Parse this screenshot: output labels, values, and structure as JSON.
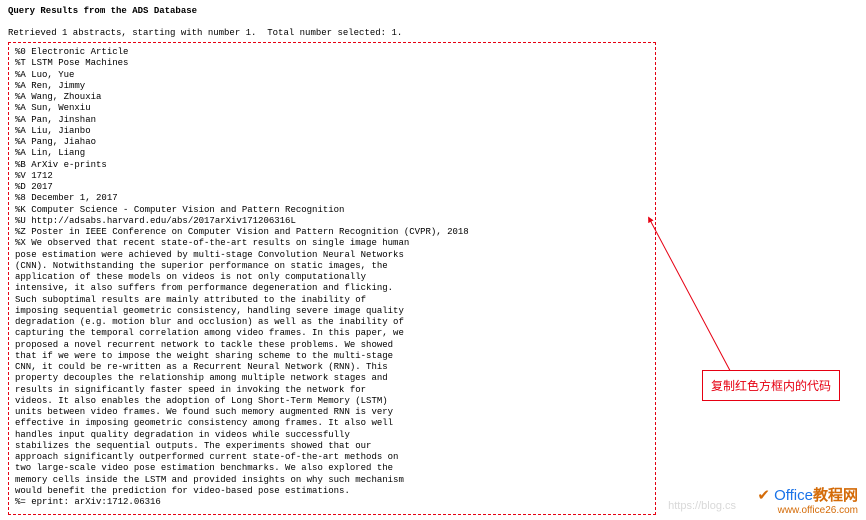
{
  "header": {
    "title": "Query Results from the ADS Database",
    "retrieved": "Retrieved 1 abstracts, starting with number 1.  Total number selected: 1."
  },
  "record": {
    "lines": [
      "%0 Electronic Article",
      "%T LSTM Pose Machines",
      "%A Luo, Yue",
      "%A Ren, Jimmy",
      "%A Wang, Zhouxia",
      "%A Sun, Wenxiu",
      "%A Pan, Jinshan",
      "%A Liu, Jianbo",
      "%A Pang, Jiahao",
      "%A Lin, Liang",
      "%B ArXiv e-prints",
      "%V 1712",
      "%D 2017",
      "%8 December 1, 2017",
      "%K Computer Science - Computer Vision and Pattern Recognition",
      "%U http://adsabs.harvard.edu/abs/2017arXiv171206316L",
      "%Z Poster in IEEE Conference on Computer Vision and Pattern Recognition (CVPR), 2018",
      "%X We observed that recent state-of-the-art results on single image human",
      "pose estimation were achieved by multi-stage Convolution Neural Networks",
      "(CNN). Notwithstanding the superior performance on static images, the",
      "application of these models on videos is not only computationally",
      "intensive, it also suffers from performance degeneration and flicking.",
      "Such suboptimal results are mainly attributed to the inability of",
      "imposing sequential geometric consistency, handling severe image quality",
      "degradation (e.g. motion blur and occlusion) as well as the inability of",
      "capturing the temporal correlation among video frames. In this paper, we",
      "proposed a novel recurrent network to tackle these problems. We showed",
      "that if we were to impose the weight sharing scheme to the multi-stage",
      "CNN, it could be re-written as a Recurrent Neural Network (RNN). This",
      "property decouples the relationship among multiple network stages and",
      "results in significantly faster speed in invoking the network for",
      "videos. It also enables the adoption of Long Short-Term Memory (LSTM)",
      "units between video frames. We found such memory augmented RNN is very",
      "effective in imposing geometric consistency among frames. It also well",
      "handles input quality degradation in videos while successfully",
      "stabilizes the sequential outputs. The experiments showed that our",
      "approach significantly outperformed current state-of-the-art methods on",
      "two large-scale video pose estimation benchmarks. We also explored the",
      "memory cells inside the LSTM and provided insights on why such mechanism",
      "would benefit the prediction for video-based pose estimations.",
      "%= eprint: arXiv:1712.06316"
    ]
  },
  "annotation": {
    "text": "复制红色方框内的代码"
  },
  "watermarks": {
    "blog": "https://blog.cs",
    "logo_main_prefix": "Office",
    "logo_main_suffix": "教程网",
    "logo_url": "www.office26.com"
  }
}
